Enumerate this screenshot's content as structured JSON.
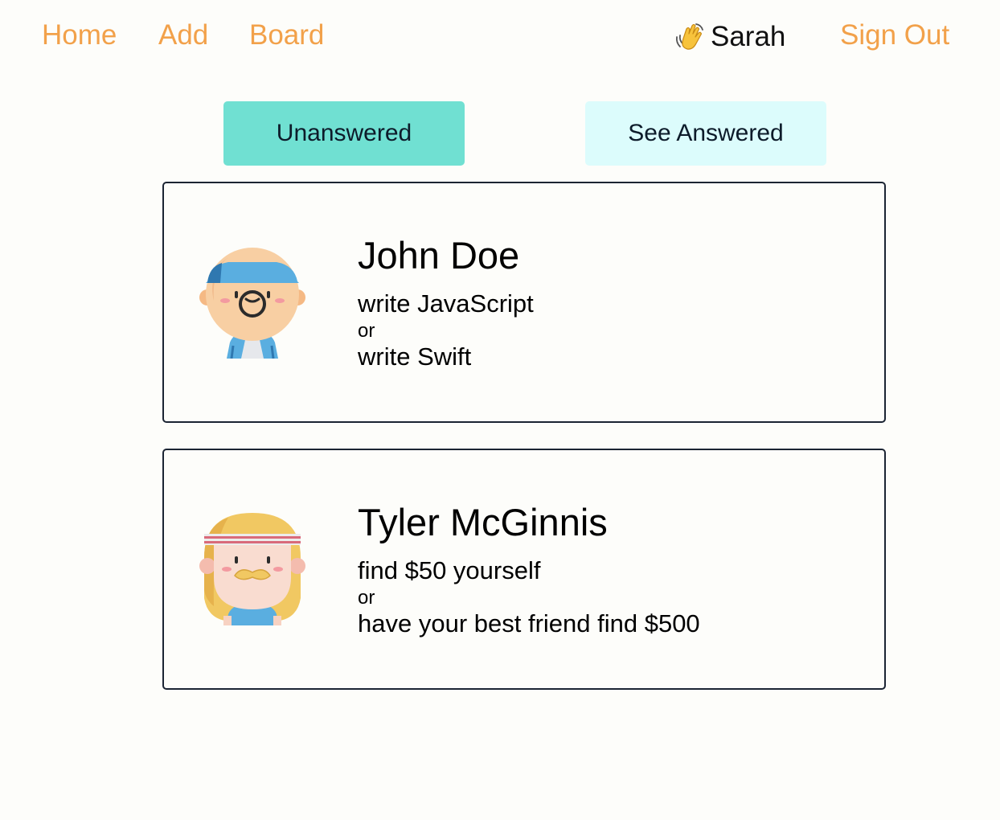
{
  "nav": {
    "home_label": "Home",
    "add_label": "Add",
    "board_label": "Board",
    "greeting_icon": "waving-hand-icon",
    "user_name": "Sarah",
    "signout_label": "Sign Out"
  },
  "tabs": {
    "unanswered_label": "Unanswered",
    "answered_label": "See Answered",
    "active": "Unanswered"
  },
  "colors": {
    "nav_link": "#f2a14a",
    "tab_active": "#70e0d2",
    "tab_inactive": "#dcfcfc",
    "card_border": "#1b2433"
  },
  "questions": [
    {
      "author": "John Doe",
      "avatar_icon": "boy-headband-avatar-icon",
      "option_one": "write JavaScript",
      "or_label": "or",
      "option_two": "write Swift"
    },
    {
      "author": "Tyler McGinnis",
      "avatar_icon": "blonde-mustache-headband-avatar-icon",
      "option_one": "find $50 yourself",
      "or_label": "or",
      "option_two": "have your best friend find $500"
    }
  ]
}
